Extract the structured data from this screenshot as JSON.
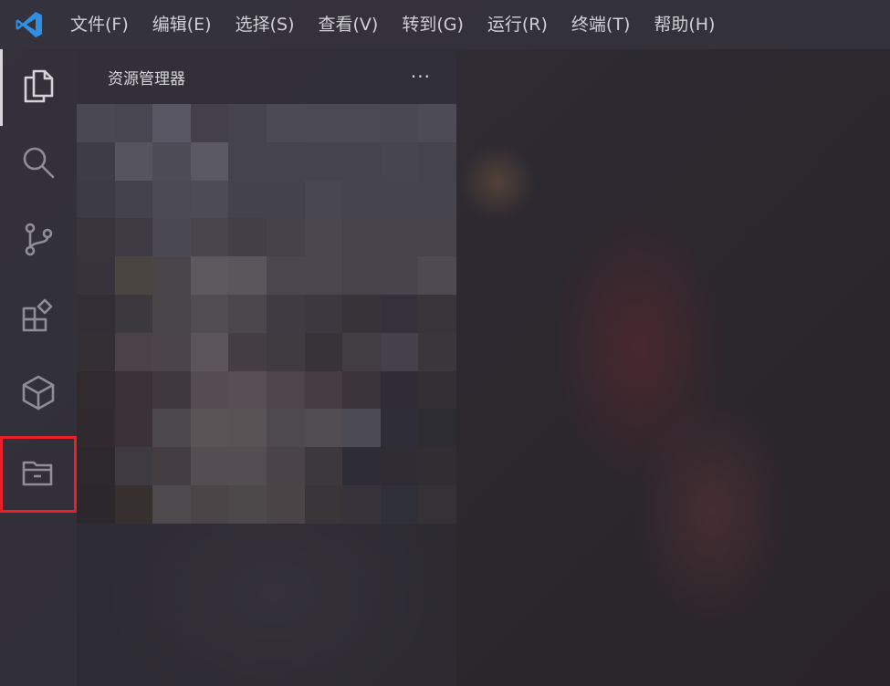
{
  "menubar": {
    "logo_icon": "vscode-logo-icon",
    "items": [
      {
        "label": "文件(F)"
      },
      {
        "label": "编辑(E)"
      },
      {
        "label": "选择(S)"
      },
      {
        "label": "查看(V)"
      },
      {
        "label": "转到(G)"
      },
      {
        "label": "运行(R)"
      },
      {
        "label": "终端(T)"
      },
      {
        "label": "帮助(H)"
      }
    ]
  },
  "activitybar": {
    "items": [
      {
        "icon": "explorer-files-icon",
        "active": true
      },
      {
        "icon": "search-icon"
      },
      {
        "icon": "source-control-icon"
      },
      {
        "icon": "extensions-icon"
      },
      {
        "icon": "package-cube-icon"
      },
      {
        "icon": "folder-open-icon",
        "highlighted": true
      }
    ]
  },
  "sidebar": {
    "title": "资源管理器",
    "more_label": "···"
  },
  "colors": {
    "accent_highlight": "#e8202a",
    "vscode_blue": "#2f8fe0",
    "menu_text": "#cfcfd4"
  }
}
